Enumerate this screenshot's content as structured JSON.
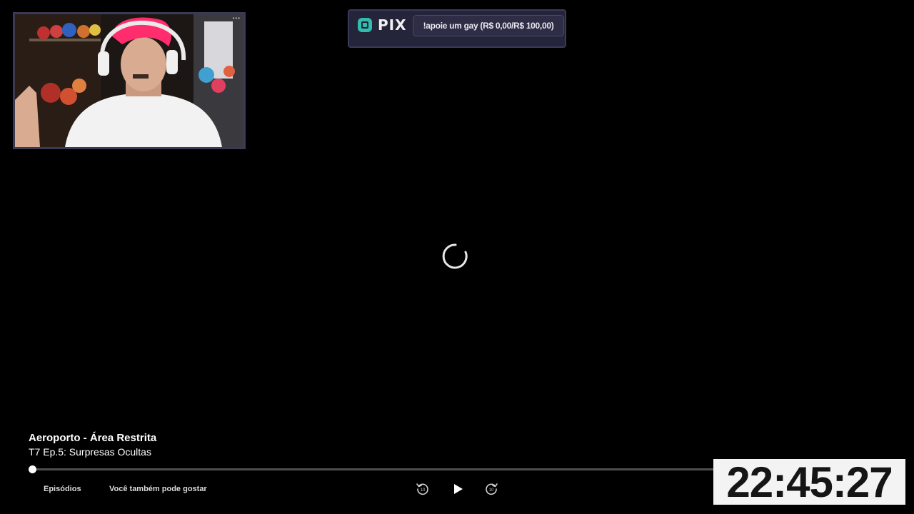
{
  "banner": {
    "logo_text": "PIX",
    "donation_text": "!apoie um gay (R$ 0,00/R$ 100,00)"
  },
  "video": {
    "show_title": "Aeroporto - Área Restrita",
    "episode_title": "T7 Ep.5: Surpresas Ocultas",
    "progress_fraction": 0.0,
    "state": "loading"
  },
  "links": {
    "episodes": "Episódios",
    "recommendations": "Você também pode gostar"
  },
  "clock": {
    "time": "22:45:27"
  },
  "icons": {
    "spinner": "loading-spinner-icon",
    "rewind": "replay-10-icon",
    "play": "play-icon",
    "forward": "forward-10-icon",
    "pix": "pix-logo-icon"
  },
  "colors": {
    "background": "#000000",
    "banner_bg": "#24243a",
    "pix_teal": "#32bcad",
    "clock_bg": "#f3f3f3"
  }
}
